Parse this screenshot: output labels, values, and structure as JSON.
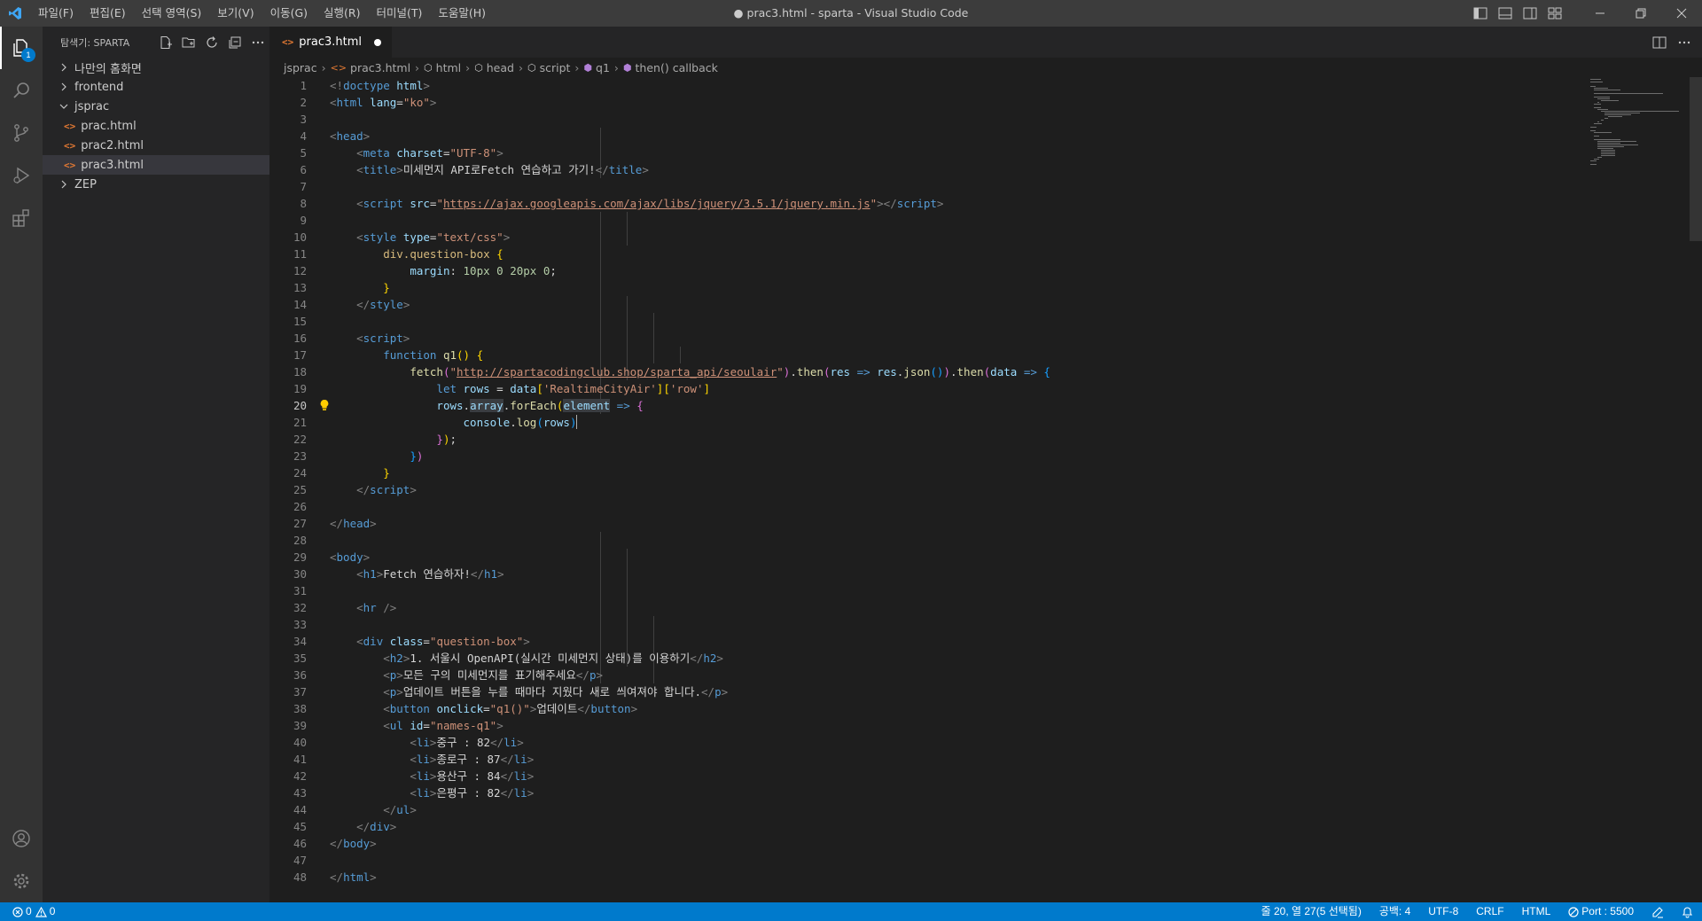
{
  "titlebar": {
    "window_title": "● prac3.html - sparta - Visual Studio Code",
    "menu": [
      "파일(F)",
      "편집(E)",
      "선택 영역(S)",
      "보기(V)",
      "이동(G)",
      "실행(R)",
      "터미널(T)",
      "도움말(H)"
    ]
  },
  "activitybar": {
    "explorer_badge": "1"
  },
  "sidebar": {
    "title": "탐색기: SPARTA",
    "items": [
      {
        "label": "나만의 홈화면",
        "type": "folder",
        "expanded": false
      },
      {
        "label": "frontend",
        "type": "folder",
        "expanded": false
      },
      {
        "label": "jsprac",
        "type": "folder",
        "expanded": true
      },
      {
        "label": "prac.html",
        "type": "file",
        "icon": "<>"
      },
      {
        "label": "prac2.html",
        "type": "file",
        "icon": "<>"
      },
      {
        "label": "prac3.html",
        "type": "file",
        "icon": "<>",
        "selected": true
      },
      {
        "label": "ZEP",
        "type": "folder",
        "expanded": false
      }
    ]
  },
  "tabs": [
    {
      "label": "prac3.html",
      "icon": "<>",
      "dirty": true,
      "active": true
    }
  ],
  "breadcrumb": [
    "jsprac",
    "prac3.html",
    "html",
    "head",
    "script",
    "q1",
    "then() callback"
  ],
  "editor": {
    "current_line": 20
  },
  "statusbar": {
    "errors": "0",
    "warnings": "0",
    "position": "줄 20, 열 27(5 선택됨)",
    "spaces": "공백: 4",
    "encoding": "UTF-8",
    "eol": "CRLF",
    "language": "HTML",
    "port": "Port : 5500"
  },
  "colors": {
    "accent": "#007acc",
    "titlebar": "#3c3c3c",
    "activitybar": "#333333",
    "sidebar": "#252526",
    "editor": "#1e1e1e"
  }
}
